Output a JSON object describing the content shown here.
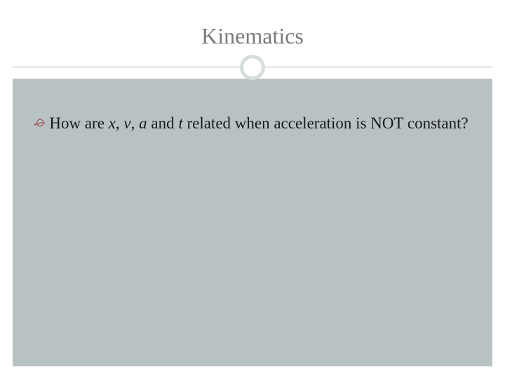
{
  "slide": {
    "title": "Kinematics",
    "bullet": {
      "prefix": "How are ",
      "var1": "x",
      "sep1": ", ",
      "var2": "v",
      "sep2": ", ",
      "var3": "a",
      "mid": " and ",
      "var4": "t",
      "suffix": " related when acceleration is NOT constant?"
    }
  }
}
